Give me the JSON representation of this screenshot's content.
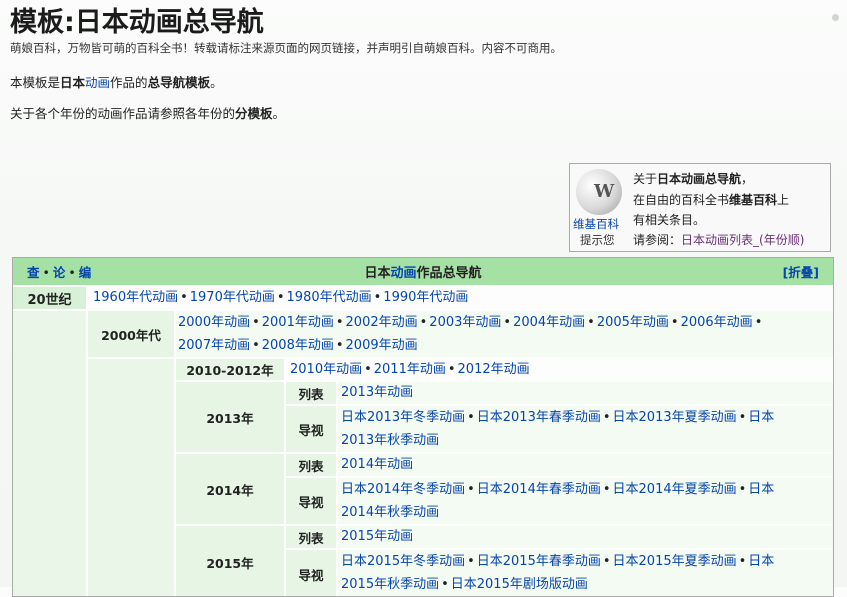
{
  "page": {
    "title": "模板:日本动画总导航",
    "subtitle": "萌娘百科，万物皆可萌的百科全书！转载请标注来源页面的网页链接，并声明引自萌娘百科。内容不可商用。",
    "para1_pre": "本模板是",
    "para1_bold1": "日本",
    "para1_link": "动画",
    "para1_mid": "作品的",
    "para1_bold2": "总导航模板",
    "para1_end": "。",
    "para2_pre": "关于各个年份的动画作品请参照各年份的",
    "para2_bold": "分模板",
    "para2_end": "。"
  },
  "wikibox": {
    "logo_glyph": "W",
    "caption1": "维基百科",
    "caption2": "提示您",
    "line1_pre": "关于",
    "line1_bold": "日本动画总导航",
    "line1_end": "，",
    "line2_pre": "在自由的百科全书",
    "line2_bold": "维基百科",
    "line2_end": "上",
    "line3": "有相关条目。",
    "line4_pre": "请参阅：",
    "line4_link": "日本动画列表_(年份顺)"
  },
  "navbox": {
    "vde": [
      "查",
      "论",
      "编"
    ],
    "title_pre": "日本",
    "title_link": "动画",
    "title_post": "作品总导航",
    "collapse": "[折叠]",
    "row_20c": {
      "label": "20世纪",
      "items": [
        "1960年代动画",
        "1970年代动画",
        "1980年代动画",
        "1990年代动画"
      ]
    },
    "row_2000s": {
      "label": "2000年代",
      "items_line1": [
        "2000年动画",
        "2001年动画",
        "2002年动画",
        "2003年动画",
        "2004年动画",
        "2005年动画",
        "2006年动画"
      ],
      "items_line2": [
        "2007年动画",
        "2008年动画",
        "2009年动画"
      ]
    },
    "row_2010_2012": {
      "label": "2010-2012年",
      "items": [
        "2010年动画",
        "2011年动画",
        "2012年动画"
      ]
    },
    "years": [
      {
        "label": "2013年",
        "list_label": "列表",
        "list_item": "2013年动画",
        "guide_label": "导视",
        "guide_line1": [
          "日本2013年冬季动画",
          "日本2013年春季动画",
          "日本2013年夏季动画",
          "日本"
        ],
        "guide_line2": [
          "2013年秋季动画"
        ]
      },
      {
        "label": "2014年",
        "list_label": "列表",
        "list_item": "2014年动画",
        "guide_label": "导视",
        "guide_line1": [
          "日本2014年冬季动画",
          "日本2014年春季动画",
          "日本2014年夏季动画",
          "日本"
        ],
        "guide_line2": [
          "2014年秋季动画"
        ]
      },
      {
        "label": "2015年",
        "list_label": "列表",
        "list_item": "2015年动画",
        "guide_label": "导视",
        "guide_line1": [
          "日本2015年冬季动画",
          "日本2015年春季动画",
          "日本2015年夏季动画",
          "日本"
        ],
        "guide_line2": [
          "2015年秋季动画",
          "日本2015年剧场版动画"
        ]
      }
    ]
  },
  "colors": {
    "title_bar": "#a5e0a5",
    "group_header": "#d8f0d6",
    "link": "#0645ad"
  }
}
